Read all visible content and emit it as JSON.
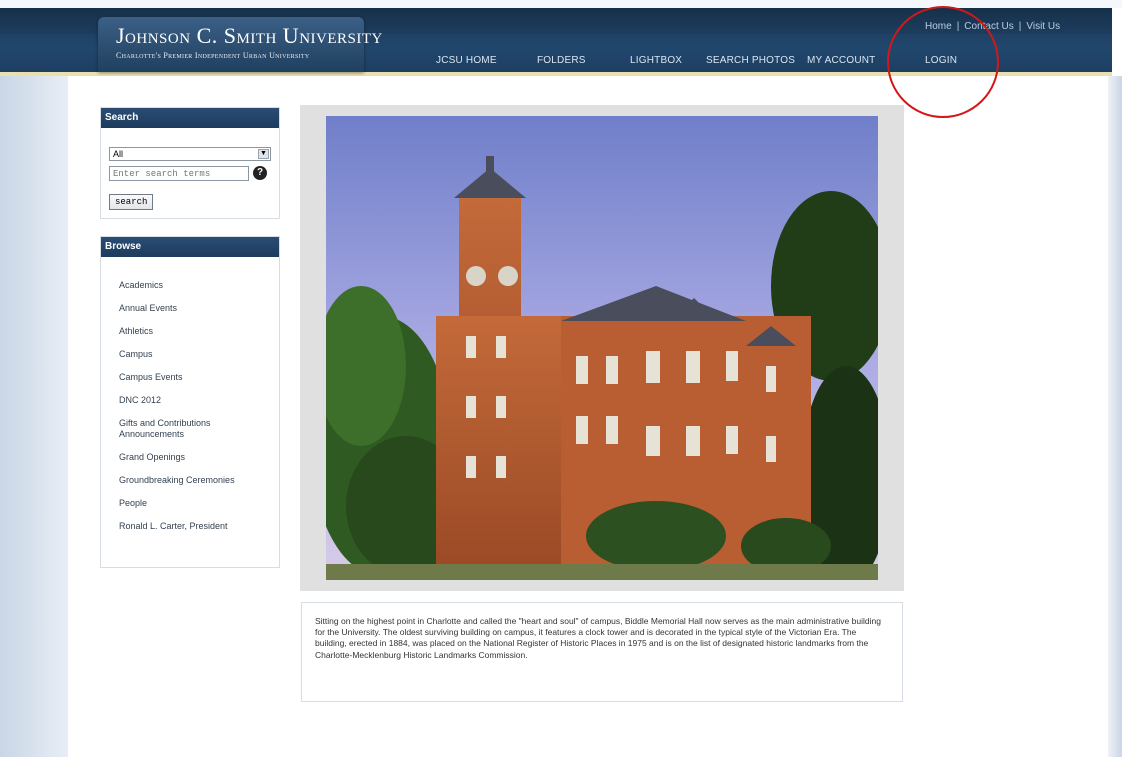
{
  "header": {
    "logo_title": "Johnson C. Smith University",
    "logo_subtitle": "Charlotte's Premier Independent Urban University",
    "top_links": [
      "Home",
      "Contact Us",
      "Visit Us"
    ],
    "nav": [
      "JCSU HOME",
      "FOLDERS",
      "LIGHTBOX",
      "SEARCH PHOTOS",
      "MY ACCOUNT",
      "LOGIN"
    ]
  },
  "search": {
    "heading": "Search",
    "scope_selected": "All",
    "placeholder": "Enter search terms",
    "help_glyph": "?",
    "button_label": "search"
  },
  "browse": {
    "heading": "Browse",
    "items": [
      "Academics",
      "Annual Events",
      "Athletics",
      "Campus",
      "Campus Events",
      "DNC 2012",
      "Gifts and Contributions Announcements",
      "Grand Openings",
      "Groundbreaking Ceremonies",
      "People",
      "Ronald L. Carter, President"
    ]
  },
  "main": {
    "caption": "Sitting on the highest point in Charlotte and called the \"heart and soul\" of campus, Biddle Memorial Hall now serves as the main administrative building for the University. The oldest surviving building on campus, it features a clock tower and is decorated in the typical style of the Victorian Era. The building, erected in 1884, was placed on the National Register of Historic Places in 1975 and is on the list of designated historic landmarks from the Charlotte-Mecklenburg Historic Landmarks Commission."
  },
  "colors": {
    "header_navy": "#21476d",
    "annotation_red": "#d21818"
  }
}
